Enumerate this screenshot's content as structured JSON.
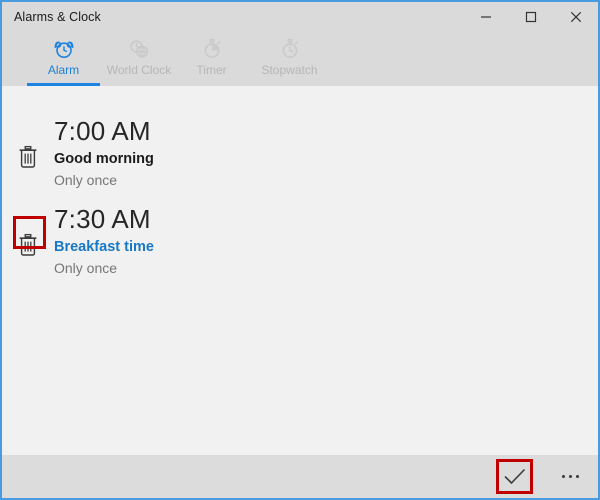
{
  "window": {
    "title": "Alarms & Clock",
    "border_color": "#4a9ae0",
    "titlebar_bg": "#dadada",
    "content_bg": "#f1f1f1",
    "controls": [
      {
        "name": "minimize",
        "glyph": "minimize-icon",
        "label": "Minimize"
      },
      {
        "name": "maximize",
        "glyph": "maximize-icon",
        "label": "Maximize"
      },
      {
        "name": "close",
        "glyph": "close-icon",
        "label": "Close"
      }
    ]
  },
  "tabs": [
    {
      "label": "Alarm",
      "icon": "alarm-clock-icon",
      "active": true,
      "color": "#1f7fd4"
    },
    {
      "label": "World Clock",
      "icon": "world-clock-icon",
      "active": false,
      "color": "#b6b6b6"
    },
    {
      "label": "Timer",
      "icon": "timer-icon",
      "active": false,
      "color": "#b6b6b6"
    },
    {
      "label": "Stopwatch",
      "icon": "stopwatch-icon",
      "active": false,
      "color": "#b6b6b6"
    }
  ],
  "accent_color": "#1f84e0",
  "highlight_color": "#c00000",
  "alarms": [
    {
      "time": "7:00 AM",
      "name": "Good morning",
      "repeat": "Only once",
      "name_color": "#1b1b1b",
      "highlighted": false,
      "delete_icon": "trash-icon"
    },
    {
      "time": "7:30 AM",
      "name": "Breakfast time",
      "repeat": "Only once",
      "name_color": "#1878c8",
      "highlighted": true,
      "delete_icon": "trash-icon"
    }
  ],
  "bottom_bar": {
    "confirm": {
      "icon": "checkmark-icon",
      "label": "Done",
      "highlighted": true
    },
    "more": {
      "icon": "more-ellipsis-icon",
      "label": "See more"
    }
  }
}
